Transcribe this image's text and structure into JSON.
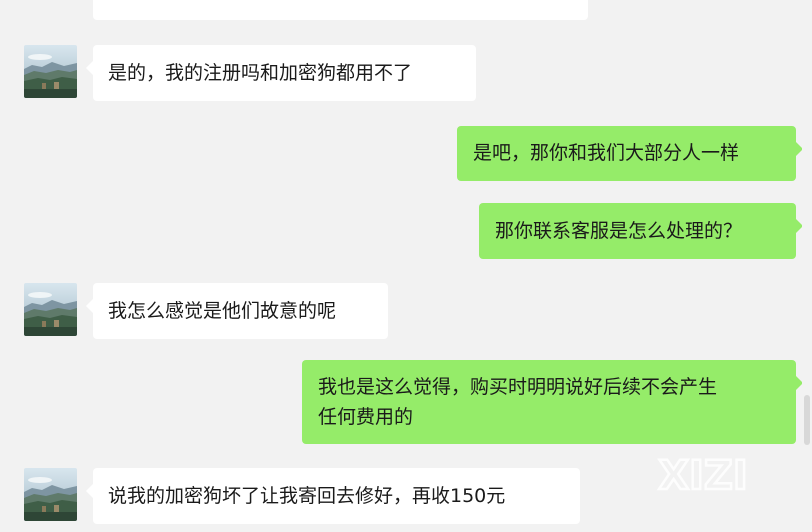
{
  "messages": [
    {
      "side": "in",
      "text": "是的，我的注册吗和加密狗都用不了"
    },
    {
      "side": "out",
      "text": "是吧，那你和我们大部分人一样"
    },
    {
      "side": "out",
      "text": "那你联系客服是怎么处理的？"
    },
    {
      "side": "in",
      "text": "我怎么感觉是他们故意的呢"
    },
    {
      "side": "out",
      "text": "我也是这么觉得，购买时明明说好后续不会产生\n任何费用的"
    },
    {
      "side": "in",
      "text": "说我的加密狗坏了让我寄回去修好，再收150元"
    }
  ],
  "watermark": {
    "text": "XIZI"
  },
  "colors": {
    "background": "#f2f2f2",
    "incoming_bubble": "#ffffff",
    "outgoing_bubble": "#95ec69",
    "text": "#1a1a1a"
  }
}
